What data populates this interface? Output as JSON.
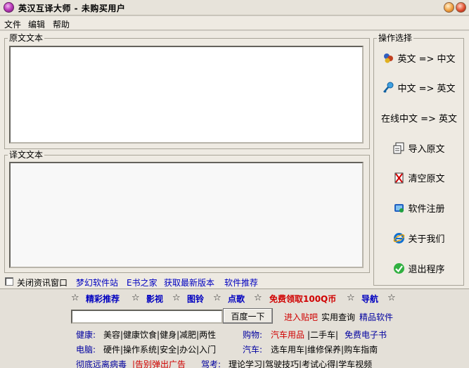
{
  "window": {
    "title": "英汉互译大师 - 未购买用户"
  },
  "menu": [
    "文件",
    "编辑",
    "帮助"
  ],
  "source_group": {
    "legend": "原文文本",
    "text": ""
  },
  "target_group": {
    "legend": "译文文本",
    "text": ""
  },
  "ops": {
    "legend": "操作选择",
    "buttons": [
      {
        "label": "英文 => 中文",
        "icon": "people-icon"
      },
      {
        "label": "中文 => 英文",
        "icon": "key-icon"
      },
      {
        "label": "在线中文 => 英文",
        "icon": ""
      },
      {
        "label": "导入原文",
        "icon": "import-icon"
      },
      {
        "label": "清空原文",
        "icon": "clear-icon"
      },
      {
        "label": "软件注册",
        "icon": "register-icon"
      },
      {
        "label": "关于我们",
        "icon": "ie-icon"
      },
      {
        "label": "退出程序",
        "icon": "exit-icon"
      }
    ]
  },
  "bottom_bar": {
    "close_info_label": "关闭资讯窗口",
    "links": [
      "梦幻软件站",
      "E书之家",
      "获取最新版本",
      "软件推荐"
    ]
  },
  "portal": {
    "nav": [
      "精彩推荐",
      "影视",
      "图铃",
      "点歌",
      "免费领取100Q币",
      "导航"
    ],
    "search_button": "百度一下",
    "search_links": [
      "进入贴吧",
      "实用查询",
      "精品软件"
    ],
    "row1": {
      "health_label": "健康:",
      "health_items": "美容|健康饮食|健身|减肥|两性",
      "shop_label": "购物:",
      "shop_red": "汽车用品",
      "shop_items": "|二手车|",
      "shop_blue": "免费电子书"
    },
    "row2": {
      "pc_label": "电脑:",
      "pc_items": "硬件|操作系统|安全|办公|入门",
      "car_label": "汽车:",
      "car_items": "选车用车|维修保养|购车指南"
    },
    "row3": {
      "virus": "彻底远离病毒",
      "popup": "|告别弹出广告",
      "drive_label": "驾考:",
      "drive_items": "理论学习|驾驶技巧|考试心得|学车视频"
    }
  },
  "colors": {
    "link": "#0000c0",
    "accent_red": "#d00000",
    "panel": "#eeeae2"
  }
}
